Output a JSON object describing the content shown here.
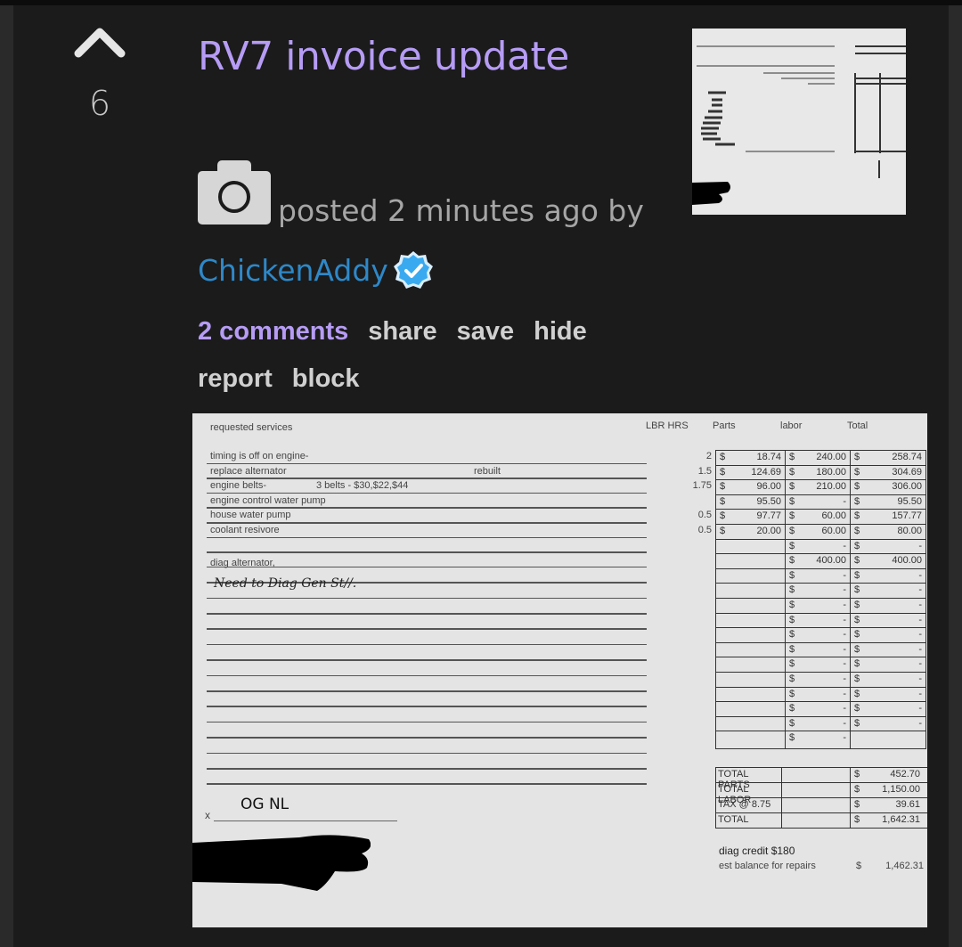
{
  "post": {
    "score": "6",
    "title": "RV7 invoice update",
    "meta_text": "posted 2 minutes ago by",
    "author": "ChickenAddy",
    "author_verified": true,
    "actions": {
      "comments": "2 comments",
      "share": "share",
      "save": "save",
      "hide": "hide",
      "report": "report",
      "block": "block"
    }
  },
  "colors": {
    "title": "#b69cf5",
    "author": "#2e88c8",
    "verified_badge": "#3aaaf0",
    "background": "#1b1b1b"
  },
  "invoice": {
    "services_header": "requested services",
    "col_headers": {
      "hours": "LBR HRS",
      "parts": "Parts",
      "labor": "labor",
      "total": "Total"
    },
    "services": [
      {
        "desc": "timing is off on engine-",
        "note": "",
        "hours": "2",
        "parts": "18.74",
        "labor": "240.00",
        "total": "258.74"
      },
      {
        "desc": "replace alternator",
        "note": "rebuilt",
        "hours": "1.5",
        "parts": "124.69",
        "labor": "180.00",
        "total": "304.69"
      },
      {
        "desc": "engine belts-",
        "note": "3 belts -     $30,$22,$44",
        "hours": "1.75",
        "parts": "96.00",
        "labor": "210.00",
        "total": "306.00"
      },
      {
        "desc": "engine control water pump",
        "note": "",
        "hours": "",
        "parts": "95.50",
        "labor": "-",
        "total": "95.50"
      },
      {
        "desc": "house water pump",
        "note": "",
        "hours": "0.5",
        "parts": "97.77",
        "labor": "60.00",
        "total": "157.77"
      },
      {
        "desc": "coolant resivore",
        "note": "",
        "hours": "0.5",
        "parts": "20.00",
        "labor": "60.00",
        "total": "80.00"
      },
      {
        "desc": "",
        "note": "",
        "hours": "",
        "parts": "",
        "labor": "-",
        "total": "-"
      },
      {
        "desc": "diag alternator,",
        "note": "",
        "hours": "",
        "parts": "",
        "labor": "400.00",
        "total": "400.00"
      }
    ],
    "handwritten_note": "Need to Diag Gen St//.",
    "blank_row_value": "-",
    "currency": "$",
    "blank_rows": 11,
    "summary": [
      {
        "label": "TOTAL PARTS",
        "value": "452.70"
      },
      {
        "label": "TOTAL LABOR",
        "value": "1,150.00"
      },
      {
        "label": "TAX @ 8.75",
        "value": "39.61"
      },
      {
        "label": "TOTAL",
        "value": "1,642.31"
      }
    ],
    "signature_prefix": "x",
    "signature": "OG NL",
    "diag_credit": "diag credit $180",
    "est_balance_label": "est balance for repairs",
    "est_balance_currency": "$",
    "est_balance_value": "1,462.31"
  }
}
